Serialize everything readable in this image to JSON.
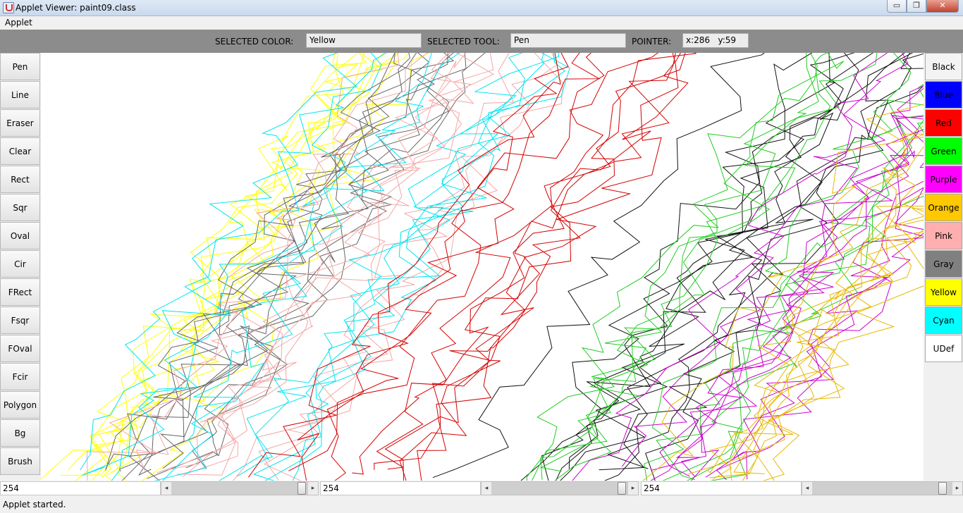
{
  "window": {
    "title": "Applet Viewer: paint09.class",
    "minimize_glyph": "▭",
    "maximize_glyph": "❐",
    "close_glyph": "✕"
  },
  "menu": {
    "applet": "Applet"
  },
  "top": {
    "selected_color_label": "SELECTED COLOR:",
    "selected_color_value": "Yellow",
    "selected_tool_label": "SELECTED TOOL:",
    "selected_tool_value": "Pen",
    "pointer_label": "POINTER:",
    "pointer_value": "x:286   y:59"
  },
  "tools": [
    "Pen",
    "Line",
    "Eraser",
    "Clear",
    "Rect",
    "Sqr",
    "Oval",
    "Cir",
    "FRect",
    "Fsqr",
    "FOval",
    "Fcir",
    "Polygon",
    "Bg",
    "Brush"
  ],
  "colors": [
    {
      "label": "Black",
      "bg": "#f3f3f3"
    },
    {
      "label": "Blue",
      "bg": "#0000ff"
    },
    {
      "label": "Red",
      "bg": "#ff0000"
    },
    {
      "label": "Green",
      "bg": "#00ff00"
    },
    {
      "label": "Purple",
      "bg": "#ff00ff"
    },
    {
      "label": "Orange",
      "bg": "#ffc800"
    },
    {
      "label": "Pink",
      "bg": "#ffafaf"
    },
    {
      "label": "Gray",
      "bg": "#808080"
    },
    {
      "label": "Yellow",
      "bg": "#ffff00"
    },
    {
      "label": "Cyan",
      "bg": "#00ffff"
    },
    {
      "label": "UDef",
      "bg": "#ffffff"
    }
  ],
  "rgb": [
    {
      "value": "254"
    },
    {
      "value": "254"
    },
    {
      "value": "254"
    }
  ],
  "status": "Applet started.",
  "strokes": [
    {
      "color": "#ffff00",
      "band": [
        0,
        330
      ]
    },
    {
      "color": "#666666",
      "band": [
        40,
        380
      ]
    },
    {
      "color": "#f4a7a7",
      "band": [
        80,
        650
      ]
    },
    {
      "color": "#00e5ef",
      "band": [
        0,
        800
      ]
    },
    {
      "color": "#d40000",
      "band": [
        280,
        1000
      ]
    },
    {
      "color": "#111111",
      "band": [
        570,
        1180
      ]
    },
    {
      "color": "#22cc22",
      "band": [
        650,
        1252
      ]
    },
    {
      "color": "#cc00cc",
      "band": [
        780,
        1252
      ]
    },
    {
      "color": "#e6b800",
      "band": [
        860,
        1252
      ]
    }
  ]
}
